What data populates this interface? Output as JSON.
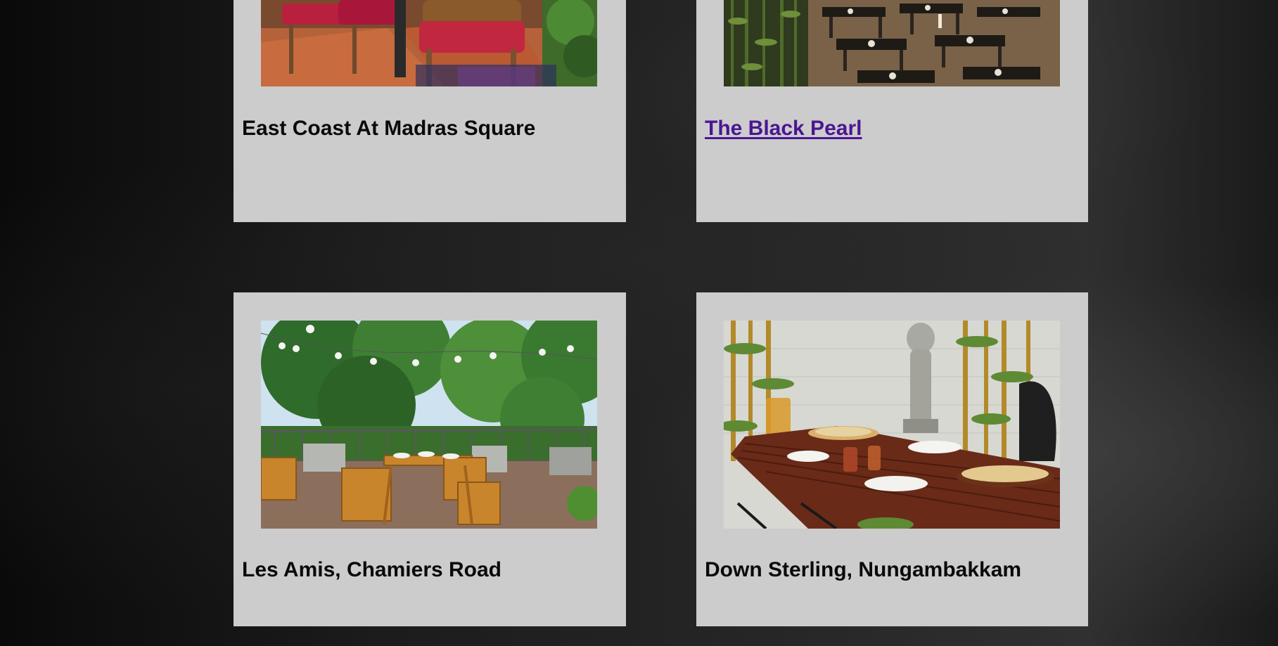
{
  "restaurants": [
    {
      "name": "East Coast At Madras Square",
      "is_link": false
    },
    {
      "name": "The Black Pearl",
      "is_link": true,
      "link_color": "#4b1692"
    },
    {
      "name": "Les Amis, Chamiers Road",
      "is_link": false
    },
    {
      "name": "Down Sterling, Nungambakkam",
      "is_link": false
    }
  ],
  "colors": {
    "card_background": "#cccccc",
    "page_background": "#1c1c1c",
    "title_text": "#0a0a0a"
  }
}
